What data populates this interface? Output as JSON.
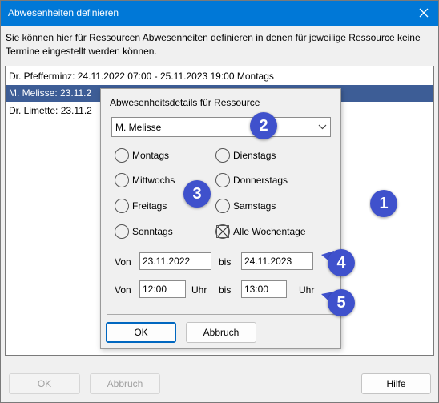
{
  "window": {
    "title": "Abwesenheiten definieren"
  },
  "description": "Sie können hier für Ressourcen Abwesenheiten definieren in denen für jeweilige Ressource keine Termine eingestellt werden können.",
  "list": {
    "rows": [
      "Dr. Pfefferminz:  24.11.2022 07:00 - 25.11.2023 19:00 Montags",
      "M. Melisse:  23.11.2",
      "Dr. Limette:  23.11.2"
    ]
  },
  "popup": {
    "header": "Abwesenheitsdetails für Ressource",
    "resource_selected": "M. Melisse",
    "weekdays": {
      "monday": "Montags",
      "tuesday": "Dienstags",
      "wednesday": "Mittwochs",
      "thursday": "Donnerstags",
      "friday": "Freitags",
      "saturday": "Samstags",
      "sunday": "Sonntags",
      "all": "Alle Wochentage"
    },
    "from_label": "Von",
    "to_label": "bis",
    "date_from": "23.11.2022",
    "date_to": "24.11.2023",
    "time_from": "12:00",
    "time_to": "13:00",
    "uhr_label": "Uhr",
    "ok_label": "OK",
    "cancel_label": "Abbruch"
  },
  "buttons": {
    "ok": "OK",
    "cancel": "Abbruch",
    "help": "Hilfe"
  },
  "badges": [
    "1",
    "2",
    "3",
    "4",
    "5"
  ],
  "colors": {
    "titlebar": "#0078d7",
    "selection": "#3d5d96",
    "badge": "#3f51cc"
  }
}
